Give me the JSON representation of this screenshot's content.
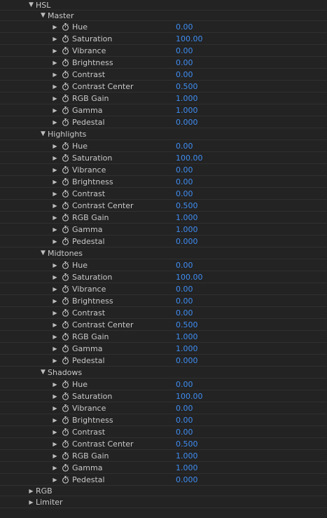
{
  "effect": {
    "title": "HSL",
    "groups": [
      {
        "label": "Master",
        "params": [
          {
            "label": "Hue",
            "value": "0.00"
          },
          {
            "label": "Saturation",
            "value": "100.00"
          },
          {
            "label": "Vibrance",
            "value": "0.00"
          },
          {
            "label": "Brightness",
            "value": "0.00"
          },
          {
            "label": "Contrast",
            "value": "0.00"
          },
          {
            "label": "Contrast Center",
            "value": "0.500"
          },
          {
            "label": "RGB Gain",
            "value": "1.000"
          },
          {
            "label": "Gamma",
            "value": "1.000"
          },
          {
            "label": "Pedestal",
            "value": "0.000"
          }
        ]
      },
      {
        "label": "Highlights",
        "params": [
          {
            "label": "Hue",
            "value": "0.00"
          },
          {
            "label": "Saturation",
            "value": "100.00"
          },
          {
            "label": "Vibrance",
            "value": "0.00"
          },
          {
            "label": "Brightness",
            "value": "0.00"
          },
          {
            "label": "Contrast",
            "value": "0.00"
          },
          {
            "label": "Contrast Center",
            "value": "0.500"
          },
          {
            "label": "RGB Gain",
            "value": "1.000"
          },
          {
            "label": "Gamma",
            "value": "1.000"
          },
          {
            "label": "Pedestal",
            "value": "0.000"
          }
        ]
      },
      {
        "label": "Midtones",
        "params": [
          {
            "label": "Hue",
            "value": "0.00"
          },
          {
            "label": "Saturation",
            "value": "100.00"
          },
          {
            "label": "Vibrance",
            "value": "0.00"
          },
          {
            "label": "Brightness",
            "value": "0.00"
          },
          {
            "label": "Contrast",
            "value": "0.00"
          },
          {
            "label": "Contrast Center",
            "value": "0.500"
          },
          {
            "label": "RGB Gain",
            "value": "1.000"
          },
          {
            "label": "Gamma",
            "value": "1.000"
          },
          {
            "label": "Pedestal",
            "value": "0.000"
          }
        ]
      },
      {
        "label": "Shadows",
        "params": [
          {
            "label": "Hue",
            "value": "0.00"
          },
          {
            "label": "Saturation",
            "value": "100.00"
          },
          {
            "label": "Vibrance",
            "value": "0.00"
          },
          {
            "label": "Brightness",
            "value": "0.00"
          },
          {
            "label": "Contrast",
            "value": "0.00"
          },
          {
            "label": "Contrast Center",
            "value": "0.500"
          },
          {
            "label": "RGB Gain",
            "value": "1.000"
          },
          {
            "label": "Gamma",
            "value": "1.000"
          },
          {
            "label": "Pedestal",
            "value": "0.000"
          }
        ]
      }
    ],
    "siblings": [
      {
        "label": "RGB"
      },
      {
        "label": "Limiter"
      }
    ]
  },
  "icons": {
    "expanded": "triangle-down-icon",
    "collapsed": "triangle-right-icon",
    "keyframe": "stopwatch-icon"
  },
  "colors": {
    "background": "#232323",
    "label": "#c9c9c9",
    "value": "#3f8df2",
    "divider": "#303030"
  }
}
